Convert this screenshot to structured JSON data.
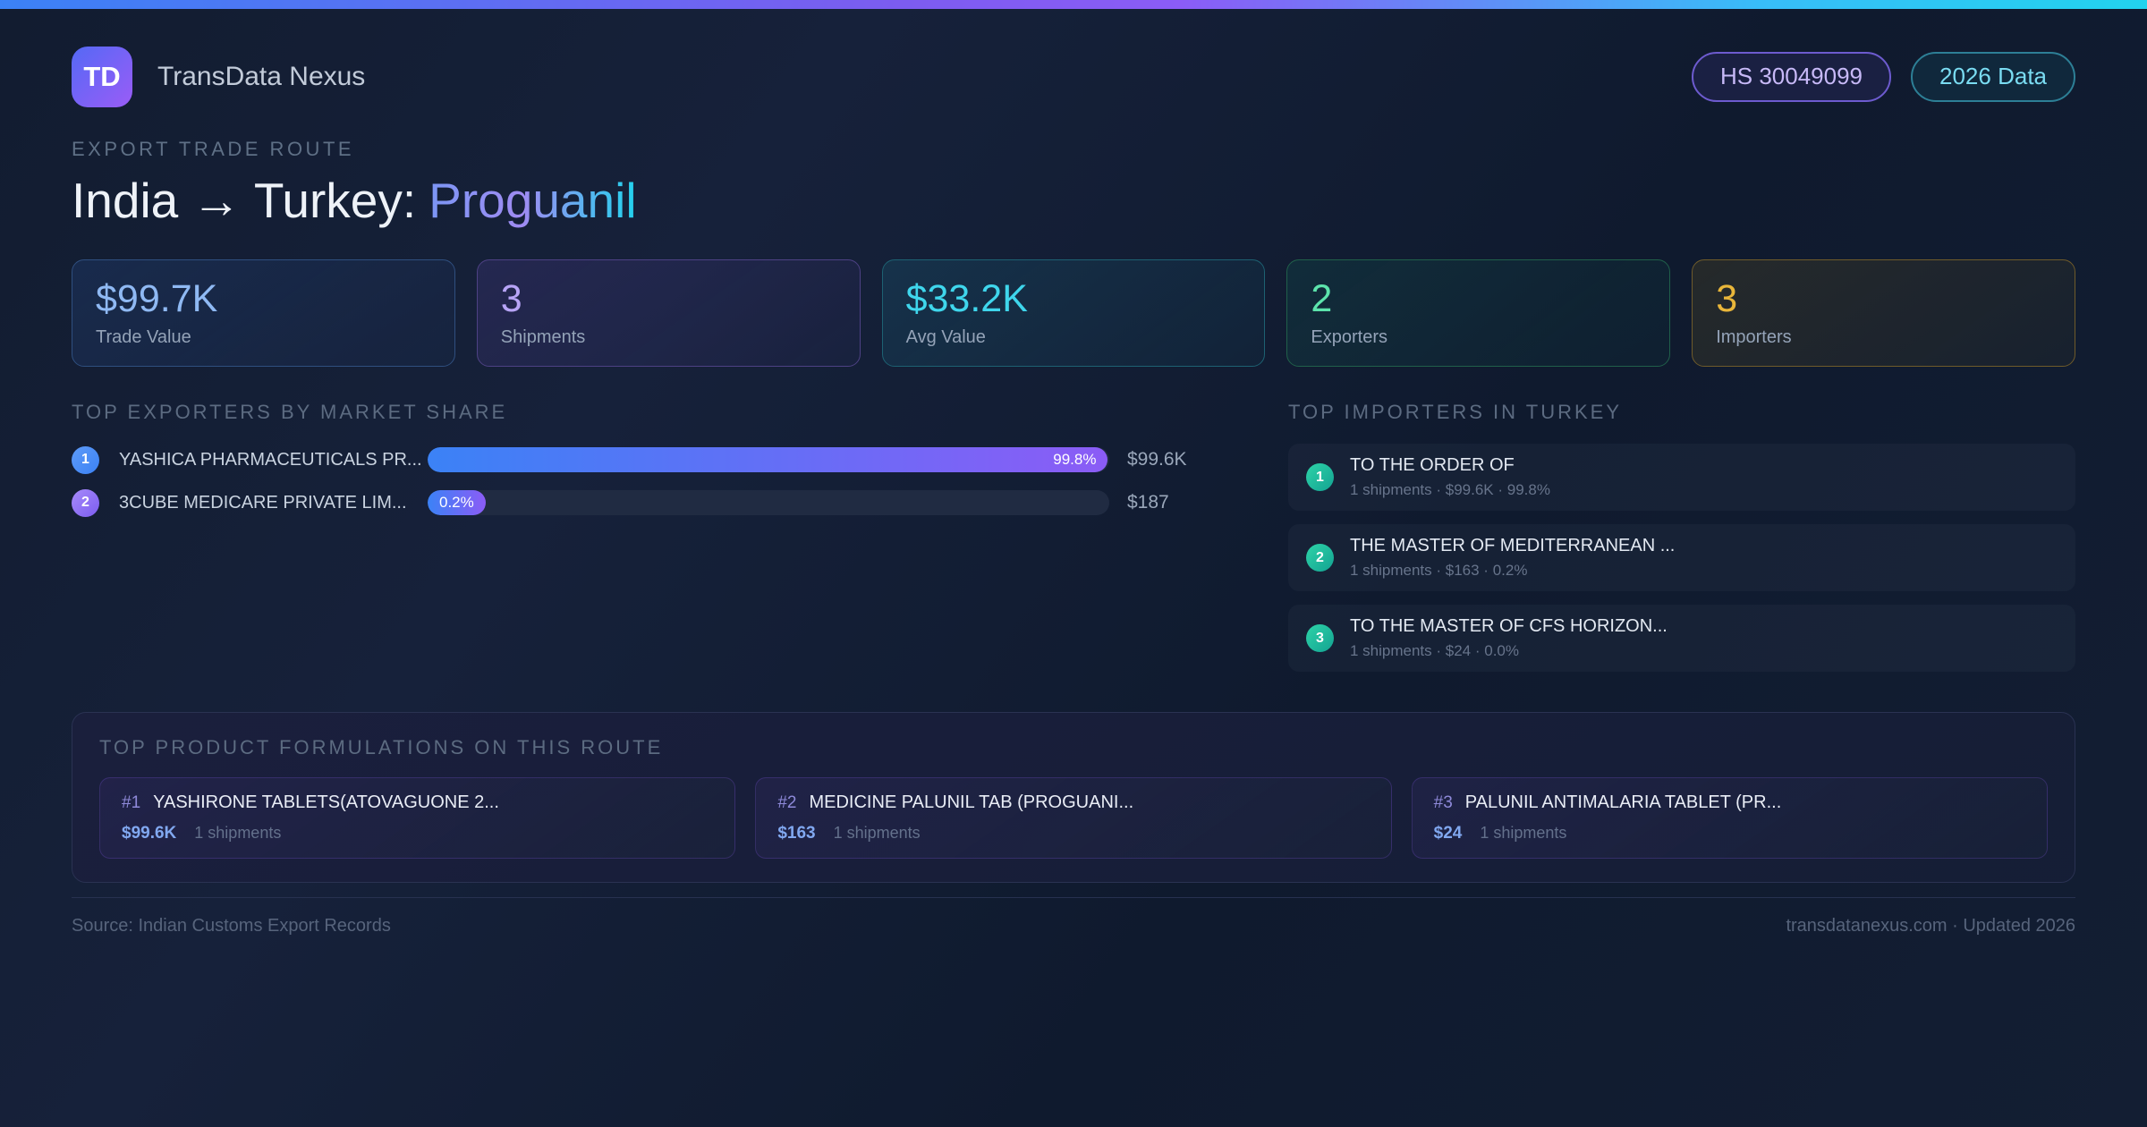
{
  "header": {
    "logo_text": "TD",
    "app_name": "TransData Nexus",
    "badges": {
      "hs_code": "HS 30049099",
      "year": "2026 Data"
    }
  },
  "hero": {
    "eyebrow": "EXPORT TRADE ROUTE",
    "title_prefix": "India → Turkey:",
    "title_highlight": "Proguanil"
  },
  "stats": [
    {
      "value": "$99.7K",
      "label": "Trade Value"
    },
    {
      "value": "3",
      "label": "Shipments"
    },
    {
      "value": "$33.2K",
      "label": "Avg Value"
    },
    {
      "value": "2",
      "label": "Exporters"
    },
    {
      "value": "3",
      "label": "Importers"
    }
  ],
  "exporters": {
    "heading": "TOP EXPORTERS BY MARKET SHARE",
    "rows": [
      {
        "rank": "1",
        "name": "YASHICA PHARMACEUTICALS PR...",
        "share_pct": 99.8,
        "share_label": "99.8%",
        "value": "$99.6K"
      },
      {
        "rank": "2",
        "name": "3CUBE MEDICARE PRIVATE LIM...",
        "share_pct": 0.2,
        "share_label": "0.2%",
        "value": "$187"
      }
    ]
  },
  "importers": {
    "heading": "TOP IMPORTERS IN TURKEY",
    "rows": [
      {
        "rank": "1",
        "name": "TO THE ORDER OF",
        "meta": "1 shipments · $99.6K · 99.8%"
      },
      {
        "rank": "2",
        "name": "THE MASTER OF MEDITERRANEAN ...",
        "meta": "1 shipments · $163 · 0.2%"
      },
      {
        "rank": "3",
        "name": "TO THE MASTER OF CFS HORIZON...",
        "meta": "1 shipments · $24 · 0.0%"
      }
    ]
  },
  "products": {
    "heading": "TOP PRODUCT FORMULATIONS ON THIS ROUTE",
    "cards": [
      {
        "rank": "#1",
        "name": "YASHIRONE TABLETS(ATOVAGUONE 2...",
        "value": "$99.6K",
        "meta": "1 shipments"
      },
      {
        "rank": "#2",
        "name": "MEDICINE PALUNIL TAB (PROGUANI...",
        "value": "$163",
        "meta": "1 shipments"
      },
      {
        "rank": "#3",
        "name": "PALUNIL ANTIMALARIA TABLET (PR...",
        "value": "$24",
        "meta": "1 shipments"
      }
    ]
  },
  "footer": {
    "source": "Source: Indian Customs Export Records",
    "site": "transdatanexus.com · Updated 2026"
  },
  "colors": {
    "accent_blue": "#3b82f6",
    "accent_purple": "#8b5cf6",
    "accent_cyan": "#22d3ee",
    "accent_green": "#10b981",
    "accent_amber": "#eab308",
    "background": "#131e33"
  }
}
